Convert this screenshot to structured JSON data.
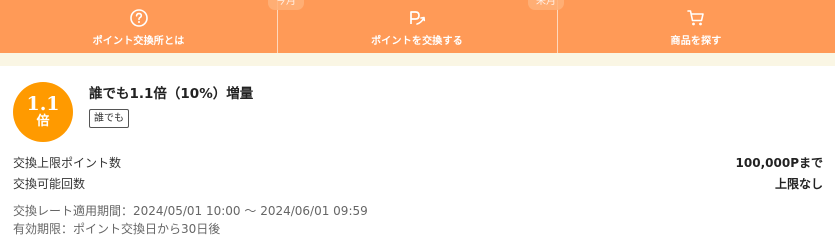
{
  "nav": {
    "items": [
      {
        "label": "ポイント交換所とは",
        "icon": "question-circle-icon"
      },
      {
        "label": "ポイントを交換する",
        "icon": "point-exchange-icon"
      },
      {
        "label": "商品を探す",
        "icon": "shopping-cart-icon"
      }
    ],
    "peek_left": "今月",
    "peek_right": "来月"
  },
  "offer": {
    "badge_number": "1.1",
    "badge_unit": "倍",
    "title": "誰でも1.1倍（10%）増量",
    "tag": "誰でも",
    "rows": [
      {
        "label": "交換上限ポイント数",
        "value": "100,000Pまで"
      },
      {
        "label": "交換可能回数",
        "value": "上限なし"
      }
    ],
    "notes": [
      "交換レート適用期間：2024/05/01 10:00 〜 2024/06/01 09:59",
      "有効期限：ポイント交換日から30日後"
    ]
  },
  "colors": {
    "nav_bg": "#ff9a57",
    "badge_bg": "#ff9a00",
    "strip_bg": "#faf6e4"
  }
}
